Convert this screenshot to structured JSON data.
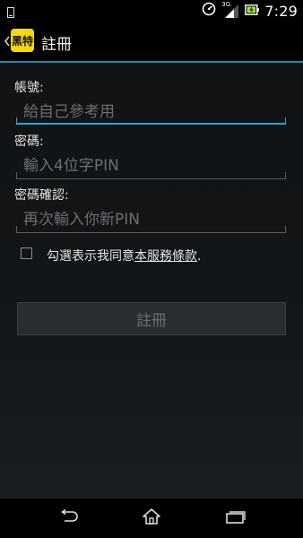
{
  "status_bar": {
    "time": "7:29",
    "network": "3G",
    "icons": [
      "notification-icon",
      "speedometer-icon",
      "signal-icon",
      "battery-charging-icon"
    ]
  },
  "action_bar": {
    "title": "註冊",
    "logo_text": "黑特",
    "logo_color": "#f5d90a"
  },
  "form": {
    "account_label": "帳號:",
    "account_placeholder": "給自己參考用",
    "password_label": "密碼:",
    "password_placeholder": "輸入4位字PIN",
    "confirm_label": "密碼確認:",
    "confirm_placeholder": "再次輸入你新PIN",
    "terms_prefix": "勾選表示我同意",
    "terms_link": "本服務條款",
    "terms_suffix": ".",
    "terms_checked": false
  },
  "register_button": {
    "label": "註冊",
    "enabled": false
  },
  "nav_bar": {
    "buttons": [
      "back-icon",
      "home-icon",
      "recent-apps-icon"
    ]
  },
  "colors": {
    "accent": "#2aa4cf",
    "background": "#121517"
  }
}
